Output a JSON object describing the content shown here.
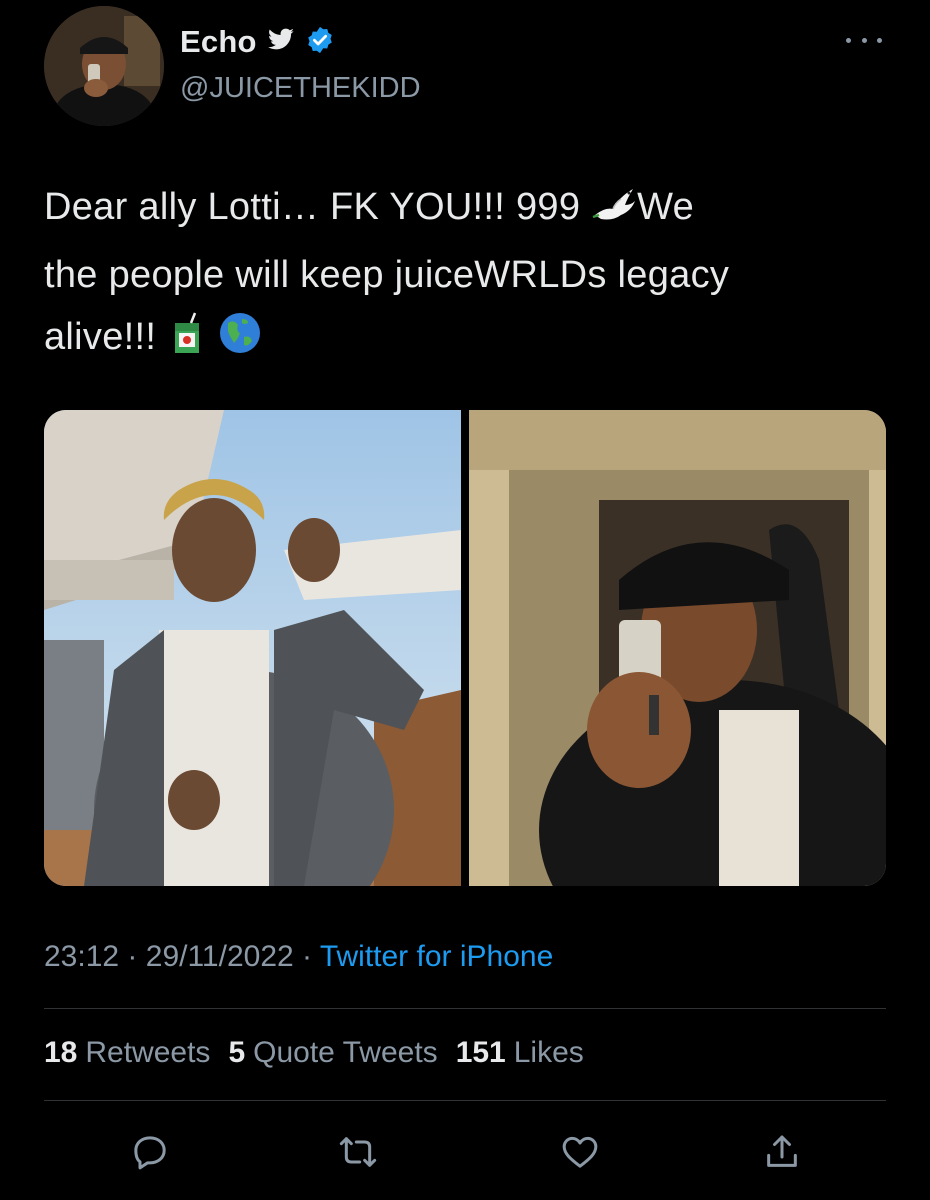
{
  "tweet": {
    "author": {
      "display_name": "Echo",
      "handle": "@JUICETHEKIDD",
      "verified": true,
      "badge_icons": [
        "twitter-bird-icon",
        "verified-badge-icon"
      ]
    },
    "text_line_1": "Dear ally Lotti… FK YOU!!! 999",
    "text_line_1b": "We",
    "text_line_2": "the people will keep juiceWRLDs legacy",
    "text_line_3": "alive!!!",
    "emojis": [
      "dove-emoji",
      "juice-box-emoji",
      "globe-emoji"
    ],
    "media": [
      "photo-1",
      "photo-2"
    ],
    "time": "23:12",
    "date": "29/11/2022",
    "source": "Twitter for iPhone",
    "separator": "·"
  },
  "stats": {
    "retweets_count": "18",
    "retweets_label": "Retweets",
    "quotes_count": "5",
    "quotes_label": "Quote Tweets",
    "likes_count": "151",
    "likes_label": "Likes"
  },
  "actions": [
    "reply-icon",
    "retweet-icon",
    "like-icon",
    "share-icon"
  ],
  "colors": {
    "background": "#000000",
    "text": "#e7e9ea",
    "secondary": "#8b98a5",
    "accent": "#1d9bf0",
    "divider": "#2f3336"
  }
}
